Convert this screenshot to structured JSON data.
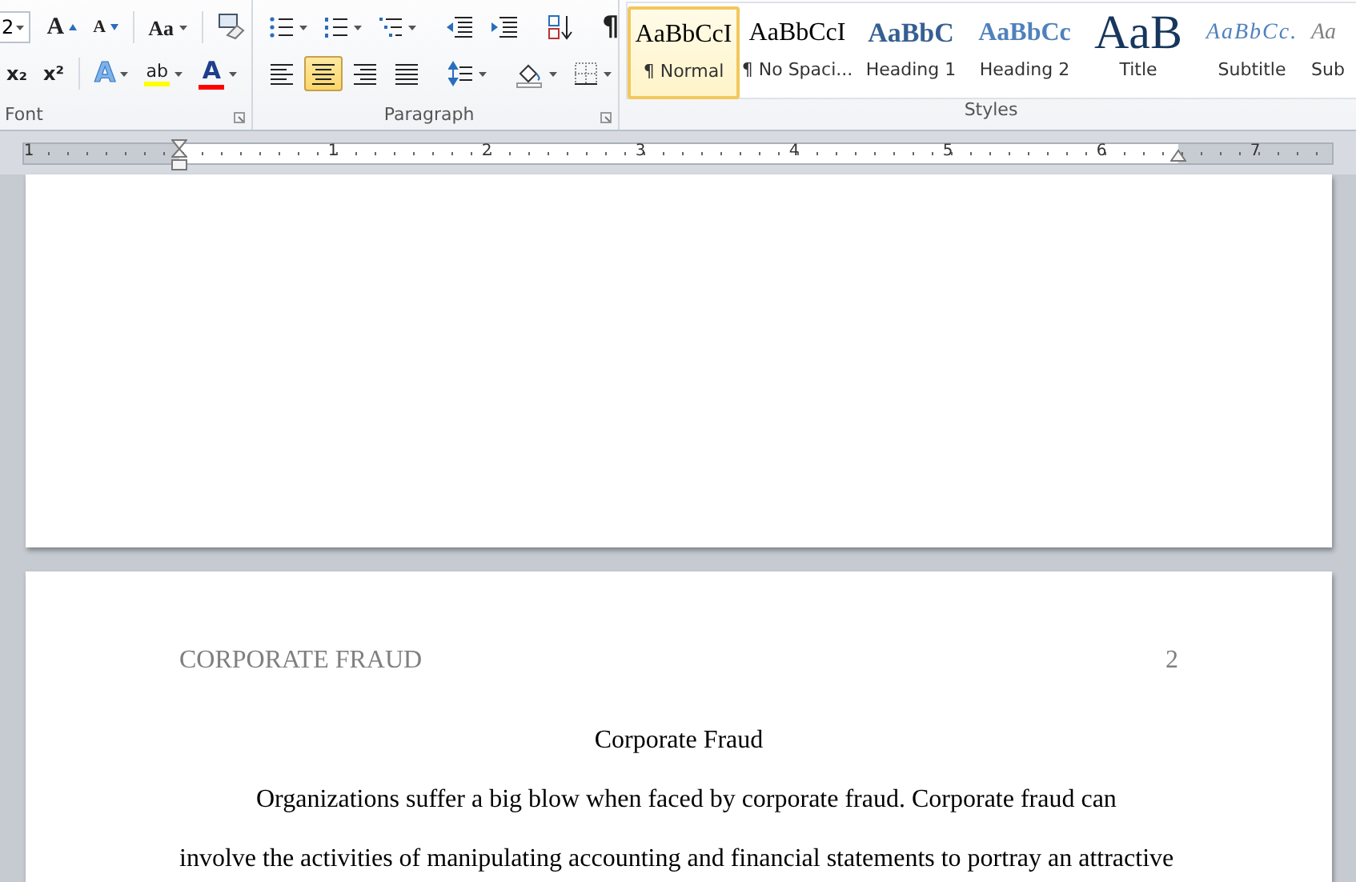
{
  "font_group": {
    "label": "Font",
    "size": "2",
    "row1": [
      {
        "kind": "grow",
        "glyph": "A"
      },
      {
        "kind": "shrink",
        "glyph": "A"
      },
      {
        "kind": "case",
        "glyph": "Aa"
      },
      {
        "kind": "clear"
      }
    ],
    "row2": [
      {
        "kind": "subscript",
        "glyph": "x₂"
      },
      {
        "kind": "superscript",
        "glyph": "x²"
      },
      {
        "kind": "effects",
        "glyph": "A"
      },
      {
        "kind": "highlight",
        "glyph": "ab"
      },
      {
        "kind": "fontcolor",
        "glyph": "A"
      }
    ]
  },
  "paragraph_group": {
    "label": "Paragraph",
    "row1": [
      {
        "kind": "bullets"
      },
      {
        "kind": "numbering"
      },
      {
        "kind": "multilevel"
      },
      {
        "kind": "outdent"
      },
      {
        "kind": "indent"
      },
      {
        "kind": "sort"
      },
      {
        "kind": "marks",
        "glyph": "¶"
      }
    ],
    "row2": [
      {
        "kind": "left",
        "selected": false
      },
      {
        "kind": "center",
        "selected": true
      },
      {
        "kind": "right",
        "selected": false
      },
      {
        "kind": "justify",
        "selected": false
      },
      {
        "kind": "spacing",
        "selected": false
      },
      {
        "kind": "shading",
        "selected": false
      },
      {
        "kind": "borders",
        "selected": false
      }
    ]
  },
  "styles_group": {
    "label": "Styles",
    "items": [
      {
        "kind": "normal",
        "preview": "AaBbCcI",
        "label": "¶ Normal",
        "selected": true
      },
      {
        "kind": "nospacing",
        "preview": "AaBbCcI",
        "label": "¶ No Spaci...",
        "selected": false
      },
      {
        "kind": "heading1",
        "preview": "AaBbC",
        "label": "Heading 1",
        "selected": false
      },
      {
        "kind": "heading2",
        "preview": "AaBbCc",
        "label": "Heading 2",
        "selected": false
      },
      {
        "kind": "title",
        "preview": "AaB",
        "label": "Title",
        "selected": false
      },
      {
        "kind": "subtitle",
        "preview": "AaBbCc.",
        "label": "Subtitle",
        "selected": false
      },
      {
        "kind": "subtle",
        "preview": "Aa",
        "label": "Sub",
        "selected": false
      }
    ]
  },
  "ruler": {
    "numbers": [
      "1",
      "1",
      "2",
      "3",
      "4",
      "5",
      "6",
      "7"
    ]
  },
  "page": {
    "header_title": "CORPORATE FRAUD",
    "page_number": "2",
    "title": "Corporate Fraud",
    "lines": [
      "Organizations suffer a big blow when faced by corporate fraud. Corporate fraud can",
      "involve the activities of manipulating accounting and financial statements to portray an attractive"
    ]
  }
}
